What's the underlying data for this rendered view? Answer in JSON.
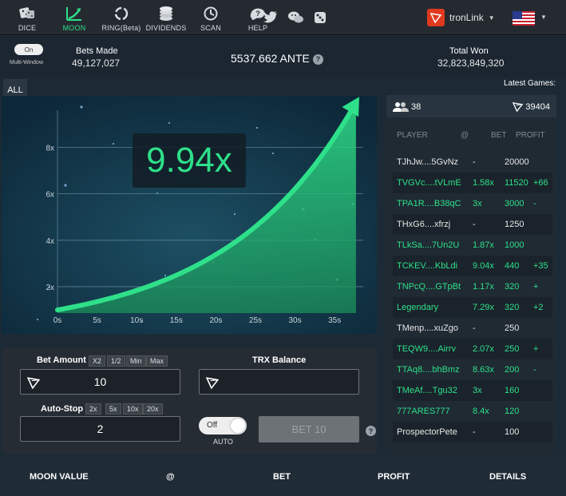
{
  "nav": {
    "items": [
      {
        "label": "DICE",
        "icon": "dice-icon"
      },
      {
        "label": "MOON",
        "icon": "moon-chart-icon"
      },
      {
        "label": "RING(Beta)",
        "icon": "ring-icon"
      },
      {
        "label": "DIVIDENDS",
        "icon": "coins-icon"
      },
      {
        "label": "SCAN",
        "icon": "scan-history-icon"
      },
      {
        "label": "HELP",
        "icon": "help-icon"
      }
    ],
    "social": [
      "twitter-icon",
      "wechat-icon",
      "dice-social-icon"
    ],
    "wallet_label": "tronLink",
    "language_icon": "us-flag-icon"
  },
  "stats": {
    "multiwindow_toggle": "On",
    "multiwindow_label": "Multi-Window",
    "bets_made_label": "Bets Made",
    "bets_made_value": "49,127,027",
    "ante_value": "5537.662 ANTE",
    "total_won_label": "Total Won",
    "total_won_value": "32,823,849,320",
    "latest_games_label": "Latest Games:"
  },
  "side": {
    "all_label": "ALL"
  },
  "chart_data": {
    "type": "area",
    "current_multiplier": "9.94x",
    "x_ticks": [
      "0s",
      "5s",
      "10s",
      "15s",
      "20s",
      "25s",
      "30s",
      "35s"
    ],
    "y_ticks": [
      "2x",
      "4x",
      "6x",
      "8x"
    ],
    "xlim": [
      0,
      37
    ],
    "ylim": [
      1,
      9.6
    ],
    "x": [
      0,
      5,
      10,
      15,
      20,
      25,
      30,
      35,
      37.7
    ],
    "y": [
      1.0,
      1.35,
      1.8,
      2.4,
      3.2,
      4.3,
      5.8,
      7.8,
      9.94
    ],
    "color": "#2ee08a"
  },
  "games": {
    "user_count": "38",
    "total_value": "39404",
    "columns": {
      "player": "PLAYER",
      "at": "@",
      "bet": "BET",
      "profit": "PROFIT"
    },
    "rows": [
      {
        "player": "TJhJw....5GvNz",
        "at": "-",
        "bet": "20000",
        "profit": "",
        "win": false
      },
      {
        "player": "TVGVc....tVLmE",
        "at": "1.58x",
        "bet": "11520",
        "profit": "+66",
        "win": true
      },
      {
        "player": "TPA1R....B38qC",
        "at": "3x",
        "bet": "3000",
        "profit": "-",
        "win": true
      },
      {
        "player": "THxG6....xfrzj",
        "at": "-",
        "bet": "1250",
        "profit": "",
        "win": false
      },
      {
        "player": "TLkSa....7Un2U",
        "at": "1.87x",
        "bet": "1000",
        "profit": "",
        "win": true
      },
      {
        "player": "TCKEV....KbLdi",
        "at": "9.04x",
        "bet": "440",
        "profit": "+35",
        "win": true
      },
      {
        "player": "TNPcQ....GTpBt",
        "at": "1.17x",
        "bet": "320",
        "profit": "+",
        "win": true
      },
      {
        "player": "Legendary",
        "at": "7.29x",
        "bet": "320",
        "profit": "+2",
        "win": true
      },
      {
        "player": "TMenp....xuZgo",
        "at": "-",
        "bet": "250",
        "profit": "",
        "win": false
      },
      {
        "player": "TEQW9....Airrv",
        "at": "2.07x",
        "bet": "250",
        "profit": "+",
        "win": true
      },
      {
        "player": "TTAq8....bhBmz",
        "at": "8.63x",
        "bet": "200",
        "profit": "-",
        "win": true
      },
      {
        "player": "TMeAf....Tgu32",
        "at": "3x",
        "bet": "160",
        "profit": "",
        "win": true
      },
      {
        "player": "777ARES777",
        "at": "8.4x",
        "bet": "120",
        "profit": "",
        "win": true
      },
      {
        "player": "ProspectorPete",
        "at": "-",
        "bet": "100",
        "profit": "",
        "win": false
      }
    ]
  },
  "bet": {
    "amount_label": "Bet Amount",
    "amount_chips": [
      "X2",
      "1/2",
      "Min",
      "Max"
    ],
    "amount_value": "10",
    "balance_label": "TRX Balance",
    "balance_value": "",
    "autostop_label": "Auto-Stop",
    "autostop_chips": [
      "2x",
      "5x",
      "10x",
      "20x"
    ],
    "autostop_value": "2",
    "auto_toggle": "Off",
    "auto_label": "AUTO",
    "button_label": "BET 10"
  },
  "bottom_header": {
    "moon_value": "MOON VALUE",
    "at": "@",
    "bet": "BET",
    "profit": "PROFIT",
    "details": "DETAILS"
  }
}
